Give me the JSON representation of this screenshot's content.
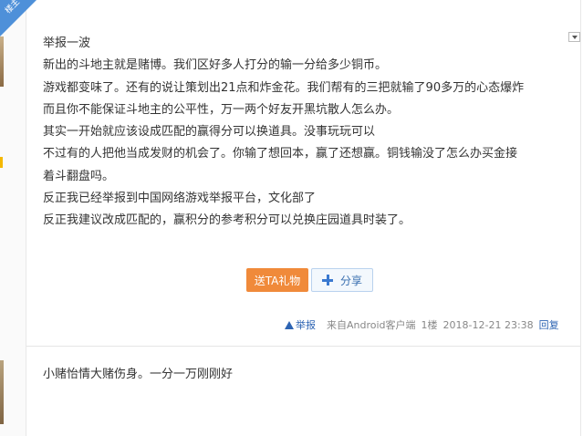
{
  "floor_badge": "楼主",
  "post": {
    "lines": [
      "举报一波",
      "新出的斗地主就是赌博。我们区好多人打分的输一分给多少铜币。",
      "游戏都变味了。还有的说让策划出21点和炸金花。我们帮有的三把就输了90多万的心态爆炸",
      "而且你不能保证斗地主的公平性，万一两个好友开黑坑散人怎么办。",
      "其实一开始就应该设成匹配的赢得分可以换道具。没事玩玩可以",
      "不过有的人把他当成发财的机会了。你输了想回本，赢了还想赢。铜钱输没了怎么办买金接",
      "着斗翻盘吗。",
      "反正我已经举报到中国网络游戏举报平台，文化部了",
      "反正我建议改成匹配的，赢积分的参考积分可以兑换庄园道具时装了。"
    ]
  },
  "actions": {
    "gift_label": "送TA礼物",
    "share_label": "分享"
  },
  "meta": {
    "report": "举报",
    "source": "来自Android客户端",
    "floor": "1楼",
    "time": "2018-12-21 23:38",
    "reply": "回复"
  },
  "reply": {
    "text": "小赌怡情大赌伤身。一分一万刚刚好"
  },
  "colors": {
    "gift_bg": "#f08a3a",
    "link": "#2d64b3",
    "badge": "#4e90d9"
  }
}
